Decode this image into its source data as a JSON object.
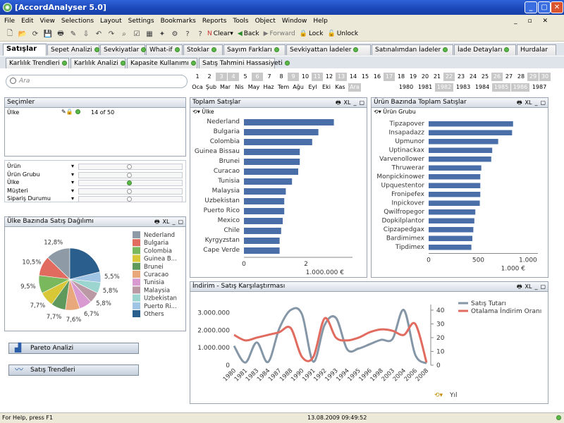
{
  "window": {
    "title": "[AccordAnalyser 5.0]"
  },
  "menu": [
    "File",
    "Edit",
    "View",
    "Selections",
    "Layout",
    "Settings",
    "Bookmarks",
    "Reports",
    "Tools",
    "Object",
    "Window",
    "Help"
  ],
  "toolbar": {
    "clear": "Clear",
    "back": "Back",
    "forward": "Forward",
    "lock": "Lock",
    "unlock": "Unlock"
  },
  "tabs_row1": [
    "Satışlar",
    "Sepet Analizi",
    "Sevkiyatlar",
    "What-if",
    "Stoklar",
    "Sayım Farkları",
    "Sevkiyattan İadeler",
    "Satınalımdan İadeler",
    "İade Detayları",
    "Hurdalar"
  ],
  "tabs_row2": [
    "Karlılık Trendleri",
    "Karlılık Analizi",
    "Kapasite Kullanımı",
    "Satış Tahmini Hassasiyeti"
  ],
  "search": {
    "placeholder": "Ara"
  },
  "days": [
    "1",
    "2",
    "3",
    "4",
    "5",
    "6",
    "7",
    "8",
    "9",
    "10",
    "11",
    "12",
    "13",
    "14",
    "15",
    "16",
    "17",
    "18",
    "19",
    "20",
    "21",
    "22",
    "23",
    "24",
    "25",
    "26",
    "27",
    "28",
    "29",
    "30"
  ],
  "days_excluded": [
    "3",
    "4",
    "6",
    "9",
    "11",
    "13",
    "17",
    "22",
    "26",
    "29",
    "30"
  ],
  "months": [
    "Oca",
    "Şub",
    "Mar",
    "Nis",
    "May",
    "Haz",
    "Tem",
    "Ağu",
    "Eyl",
    "Eki",
    "Kas",
    "Ara"
  ],
  "months_excluded": [
    "Ara"
  ],
  "years": [
    "1980",
    "1981",
    "1982",
    "1983",
    "1984",
    "1985",
    "1986",
    "1987"
  ],
  "years_excluded": [
    "1982",
    "1985",
    "1986"
  ],
  "selections": {
    "title": "Seçimler",
    "field": "Ülke",
    "value": "14 of 50"
  },
  "filters": [
    "Ürün",
    "Ürün Grubu",
    "Ülke",
    "Müşteri",
    "Sipariş Durumu"
  ],
  "pie": {
    "title": "Ülke Bazında Satış Dağılımı",
    "xl": "XL"
  },
  "buttons": {
    "pareto": "Pareto Analizi",
    "trend": "Satış Trendleri"
  },
  "bar1": {
    "title": "Toplam Satışlar",
    "dim": "Ülke",
    "unit": "1.000.000 €",
    "xl": "XL"
  },
  "bar2": {
    "title": "Ürün Bazında Toplam Satışlar",
    "dim": "Ürün Grubu",
    "unit": "1.000 €",
    "xl": "XL"
  },
  "line": {
    "title": "İndirim - Satış Karşılaştırması",
    "xlabel": "Yıl",
    "xl": "XL"
  },
  "status": {
    "help": "For Help, press F1",
    "datetime": "13.08.2009 09:49:52"
  },
  "colors": {
    "title": "#2450c4",
    "green": "#5cb848",
    "bar": "#4a6fa8",
    "line1": "#8596a6",
    "line2": "#e26b5f"
  },
  "chart_data": [
    {
      "type": "pie",
      "title": "Ülke Bazında Satış Dağılımı",
      "categories": [
        "Nederland",
        "Bulgaria",
        "Colombia",
        "Guinea B...",
        "Brunei",
        "Curacao",
        "Tunisia",
        "Malaysia",
        "Uzbekistan",
        "Puerto Ri...",
        "Others"
      ],
      "values": [
        12.8,
        10.5,
        9.5,
        7.7,
        7.7,
        7.6,
        6.7,
        5.8,
        5.8,
        5.5,
        21.4
      ],
      "labels": [
        "12,8%",
        "10,5%",
        "9,5%",
        "7,7%",
        "7,7%",
        "7,6%",
        "6,7%",
        "5,8%",
        "5,8%",
        "5,5%",
        ""
      ],
      "colors": [
        "#8e9aa6",
        "#e26b5f",
        "#7ab85e",
        "#d8c838",
        "#5f9a5c",
        "#e8a87c",
        "#d89ad0",
        "#ba98a4",
        "#9cd4d0",
        "#a0c4e4",
        "#2a5e8c"
      ]
    },
    {
      "type": "bar",
      "title": "Toplam Satışlar",
      "categories": [
        "Nederland",
        "Bulgaria",
        "Colombia",
        "Guinea Bissau",
        "Brunei",
        "Curacao",
        "Tunisia",
        "Malaysia",
        "Uzbekistan",
        "Puerto Rico",
        "Mexico",
        "Chile",
        "Kyrgyzstan",
        "Cape Verde"
      ],
      "values": [
        2.9,
        2.4,
        2.2,
        1.8,
        1.8,
        1.75,
        1.55,
        1.35,
        1.3,
        1.3,
        1.25,
        1.2,
        1.15,
        1.15
      ],
      "xlim": [
        0,
        3.5
      ],
      "xticks": [
        "0",
        "2"
      ],
      "unit": "1.000.000 €"
    },
    {
      "type": "bar",
      "title": "Ürün Bazında Toplam Satışlar",
      "categories": [
        "Tipzapover",
        "Insapadazz",
        "Upmunor",
        "Uptinackax",
        "Varvenollower",
        "Thruwerar",
        "Monpickinower",
        "Upquestentor",
        "Fronipefex",
        "Inpickover",
        "Qwilfropegor",
        "Dopkilplantor",
        "Cipzapedgax",
        "Bardimimex",
        "Tipdimex"
      ],
      "values": [
        850,
        840,
        700,
        640,
        630,
        530,
        520,
        520,
        520,
        515,
        470,
        460,
        450,
        440,
        430
      ],
      "xlim": [
        0,
        1100
      ],
      "xticks": [
        "0",
        "500",
        "1.000"
      ],
      "unit": "1.000 €"
    },
    {
      "type": "line",
      "title": "İndirim - Satış Karşılaştırması",
      "x": [
        "1980",
        "1981",
        "1983",
        "1984",
        "1987",
        "1988",
        "1990",
        "1991",
        "1992",
        "1993",
        "1994",
        "1995",
        "1996",
        "1998",
        "2003",
        "2004",
        "2006",
        "2008"
      ],
      "series": [
        {
          "name": "Satış Tutarı",
          "axis": "left",
          "values": [
            1100000,
            150000,
            1300000,
            180000,
            2100000,
            3150000,
            2900000,
            200000,
            2300000,
            2700000,
            900000,
            950000,
            1200000,
            1450000,
            1500000,
            3150000,
            600000,
            100000
          ]
        },
        {
          "name": "Otalama İndirim Oranı",
          "axis": "right",
          "values": [
            22,
            18,
            20,
            22,
            24,
            27,
            6,
            6,
            34,
            20,
            18,
            20,
            24,
            26,
            25,
            22,
            30,
            2
          ]
        }
      ],
      "yticks_left": [
        "0",
        "1.000.000",
        "2.000.000",
        "3.000.000"
      ],
      "yticks_right": [
        "0",
        "10",
        "20",
        "30",
        "40"
      ],
      "xlabel": "Yıl"
    }
  ]
}
